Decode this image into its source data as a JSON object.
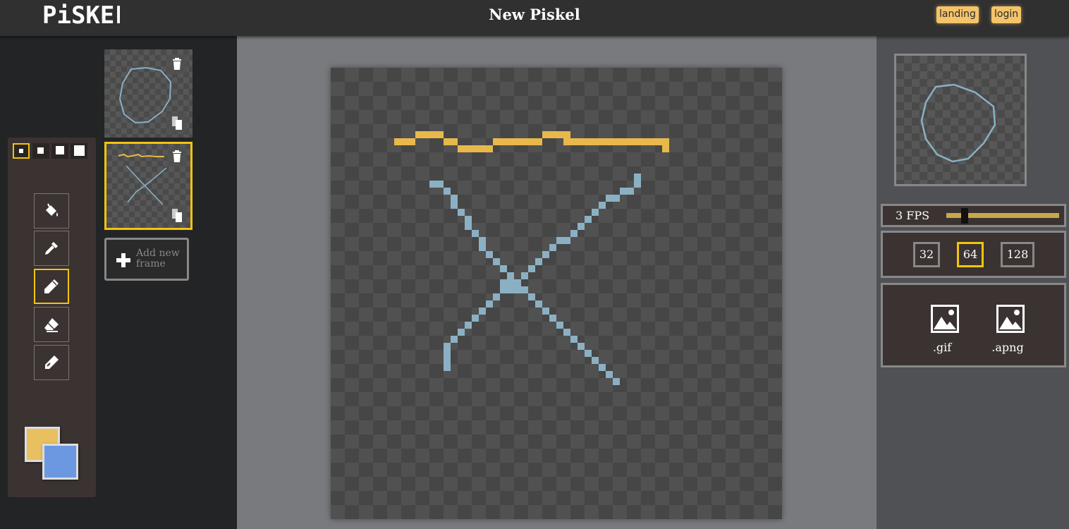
{
  "header": {
    "logo": "PiSKEL",
    "title": "New Piskel",
    "buttons": {
      "landing": "landing",
      "login": "login"
    }
  },
  "tools": {
    "pen_sizes": [
      1,
      2,
      3,
      4
    ],
    "selected_pen_size": 1,
    "items": [
      {
        "name": "paint-bucket",
        "icon": "paint-bucket-icon"
      },
      {
        "name": "color-picker",
        "icon": "eyedropper-icon"
      },
      {
        "name": "pen",
        "icon": "pencil-icon",
        "selected": true
      },
      {
        "name": "eraser",
        "icon": "eraser-icon"
      },
      {
        "name": "lighten",
        "icon": "lighten-icon"
      }
    ],
    "primary_color": "#e8c060",
    "secondary_color": "#6b98e0"
  },
  "frames": {
    "items": [
      {
        "index": 1,
        "selected": false
      },
      {
        "index": 2,
        "selected": true
      }
    ],
    "add_label": "Add new frame"
  },
  "canvas": {
    "grid_size": 64,
    "yellow": "#e8b94a",
    "blue": "#8bb0c4"
  },
  "animation": {
    "fps_label": "3 FPS",
    "fps": 3
  },
  "resize": {
    "options": [
      "32",
      "64",
      "128"
    ],
    "selected": "64"
  },
  "export": {
    "formats": [
      ".gif",
      ".apng"
    ]
  }
}
